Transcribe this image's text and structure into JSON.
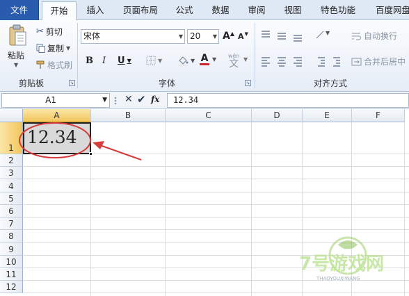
{
  "tabs": [
    {
      "label": "文件",
      "kind": "file"
    },
    {
      "label": "开始",
      "kind": "active"
    },
    {
      "label": "插入"
    },
    {
      "label": "页面布局"
    },
    {
      "label": "公式"
    },
    {
      "label": "数据"
    },
    {
      "label": "审阅"
    },
    {
      "label": "视图"
    },
    {
      "label": "特色功能"
    },
    {
      "label": "百度网盘"
    }
  ],
  "clipboard": {
    "paste": "粘贴",
    "cut": "剪切",
    "copy": "复制",
    "format_painter": "格式刷",
    "label": "剪贴板"
  },
  "font": {
    "name": "宋体",
    "size": "20",
    "bold": "B",
    "italic": "I",
    "underline": "U",
    "grow": "A",
    "shrink": "A",
    "font_color_glyph": "A",
    "phonetic": "wén",
    "label": "字体",
    "accent_color": "#d1242a"
  },
  "alignment": {
    "wrap_text": "自动换行",
    "merge_center": "合并后居中",
    "label": "对齐方式"
  },
  "formula_bar": {
    "name_box": "A1",
    "fx": "fx",
    "content": "12.34"
  },
  "columns": [
    "A",
    "B",
    "C",
    "D",
    "E",
    "F"
  ],
  "rows": [
    "1",
    "2",
    "3",
    "4",
    "5",
    "6",
    "7",
    "8",
    "9",
    "10",
    "11",
    "12"
  ],
  "cell_a1": "12.34",
  "watermark": {
    "brand": "7号游戏网",
    "pinyin": "THAOYOUXIWANG"
  },
  "colors": {
    "file_tab": "#2a5cad",
    "annotation": "#d63c3c",
    "selected_header": "#f2c55c"
  }
}
